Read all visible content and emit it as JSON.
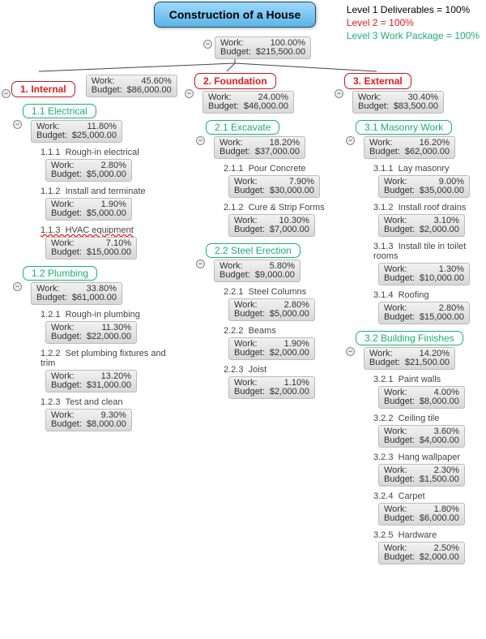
{
  "legend": {
    "l1": "Level 1 Deliverables = 100%",
    "l2": "Level 2 = 100%",
    "l3": "Level 3 Work Package = 100%"
  },
  "root": {
    "title": "Construction of a House",
    "work": "100.00%",
    "budget": "$215,500.00"
  },
  "columns": [
    {
      "number": "1.",
      "name": "Internal",
      "work": "45.60%",
      "budget": "$86,000.00",
      "subs": [
        {
          "number": "1.1",
          "name": "Electrical",
          "work": "11.80%",
          "budget": "$25,000.00",
          "items": [
            {
              "number": "1.1.1",
              "name": "Rough-in electrical",
              "work": "2.80%",
              "budget": "$5,000.00"
            },
            {
              "number": "1.1.2",
              "name": "Install and terminate",
              "work": "1.90%",
              "budget": "$5,000.00"
            },
            {
              "number": "1.1.3",
              "name": "HVAC equipment",
              "work": "7.10%",
              "budget": "$15,000.00",
              "wavy": "1"
            }
          ]
        },
        {
          "number": "1.2",
          "name": "Plumbing",
          "work": "33.80%",
          "budget": "$61,000.00",
          "items": [
            {
              "number": "1.2.1",
              "name": "Rough-in plumbing",
              "work": "11.30%",
              "budget": "$22,000.00"
            },
            {
              "number": "1.2.2",
              "name": "Set plumbing fixtures and trim",
              "work": "13.20%",
              "budget": "$31,000.00"
            },
            {
              "number": "1.2.3",
              "name": "Test and clean",
              "work": "9.30%",
              "budget": "$8,000.00"
            }
          ]
        }
      ]
    },
    {
      "number": "2.",
      "name": "Foundation",
      "work": "24.00%",
      "budget": "$46,000.00",
      "subs": [
        {
          "number": "2.1",
          "name": "Excavate",
          "work": "18.20%",
          "budget": "$37,000.00",
          "items": [
            {
              "number": "2.1.1",
              "name": "Pour Concrete",
              "work": "7.90%",
              "budget": "$30,000.00"
            },
            {
              "number": "2.1.2",
              "name": "Cure & Strip Forms",
              "work": "10.30%",
              "budget": "$7,000.00"
            }
          ]
        },
        {
          "number": "2.2",
          "name": "Steel Erection",
          "work": "5.80%",
          "budget": "$9,000.00",
          "items": [
            {
              "number": "2.2.1",
              "name": "Steel Columns",
              "work": "2.80%",
              "budget": "$5,000.00"
            },
            {
              "number": "2.2.2",
              "name": "Beams",
              "work": "1.90%",
              "budget": "$2,000.00"
            },
            {
              "number": "2.2.3",
              "name": "Joist",
              "work": "1.10%",
              "budget": "$2,000.00"
            }
          ]
        }
      ]
    },
    {
      "number": "3.",
      "name": "External",
      "work": "30.40%",
      "budget": "$83,500.00",
      "subs": [
        {
          "number": "3.1",
          "name": "Masonry Work",
          "work": "16.20%",
          "budget": "$62,000.00",
          "items": [
            {
              "number": "3.1.1",
              "name": "Lay masonry",
              "work": "9.00%",
              "budget": "$35,000.00"
            },
            {
              "number": "3.1.2",
              "name": "Install roof drains",
              "work": "3.10%",
              "budget": "$2,000.00"
            },
            {
              "number": "3.1.3",
              "name": "Install tile in toilet rooms",
              "work": "1.30%",
              "budget": "$10,000.00"
            },
            {
              "number": "3.1.4",
              "name": "Roofing",
              "work": "2.80%",
              "budget": "$15,000.00"
            }
          ]
        },
        {
          "number": "3.2",
          "name": "Building Finishes",
          "work": "14.20%",
          "budget": "$21,500.00",
          "items": [
            {
              "number": "3.2.1",
              "name": "Paint walls",
              "work": "4.00%",
              "budget": "$8,000.00"
            },
            {
              "number": "3.2.2",
              "name": "Ceiling tile",
              "work": "3.60%",
              "budget": "$4,000.00"
            },
            {
              "number": "3.2.3",
              "name": "Hang wallpaper",
              "work": "2.30%",
              "budget": "$1,500.00"
            },
            {
              "number": "3.2.4",
              "name": "Carpet",
              "work": "1.80%",
              "budget": "$6,000.00"
            },
            {
              "number": "3.2.5",
              "name": "Hardware",
              "work": "2.50%",
              "budget": "$2,000.00"
            }
          ]
        }
      ]
    }
  ],
  "labels": {
    "work": "Work:",
    "budget": "Budget:"
  },
  "toggle": "−"
}
